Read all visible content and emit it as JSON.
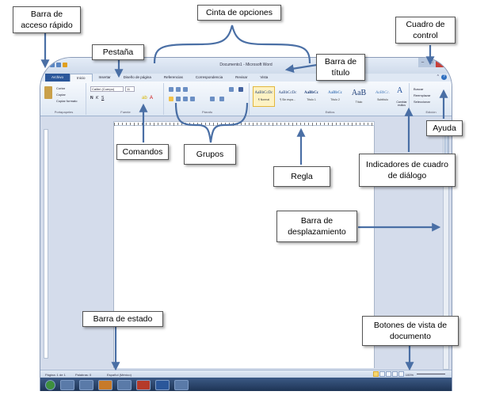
{
  "word": {
    "title": "Documento1 - Microsoft Word",
    "tabs": [
      "Archivo",
      "Inicio",
      "Insertar",
      "Diseño de página",
      "Referencias",
      "Correspondencia",
      "Revisar",
      "Vista"
    ],
    "active_tab": "Inicio",
    "groups": {
      "clipboard": {
        "label": "Portapapeles",
        "cut": "Cortar",
        "copy": "Copiar",
        "paste_format": "Copiar formato"
      },
      "font": {
        "label": "Fuente",
        "font_name": "Calibri (Cuerpo)",
        "font_size": "11"
      },
      "paragraph": {
        "label": "Párrafo"
      },
      "styles": {
        "label": "Estilos",
        "items": [
          {
            "sample": "AaBbCcDc",
            "name": "¶ Normal"
          },
          {
            "sample": "AaBbCcDc",
            "name": "¶ Sin espa..."
          },
          {
            "sample": "AaBbCc",
            "name": "Título 1"
          },
          {
            "sample": "AaBbCc",
            "name": "Título 2"
          },
          {
            "sample": "AaB",
            "name": "Título"
          },
          {
            "sample": "AaBbCc.",
            "name": "Subtítulo"
          }
        ],
        "change_styles": "Cambiar estilos"
      },
      "editing": {
        "label": "Edición",
        "find": "Buscar",
        "replace": "Reemplazar",
        "select": "Seleccionar"
      }
    },
    "status": {
      "page": "Página: 1 de 1",
      "words": "Palabras: 0",
      "language": "Español (México)",
      "zoom": "100%"
    }
  },
  "callouts": {
    "barra_acceso": "Barra de acceso rápido",
    "pestana": "Pestaña",
    "cinta": "Cinta de opciones",
    "barra_titulo": "Barra de título",
    "cuadro_control": "Cuadro de control",
    "ayuda": "Ayuda",
    "comandos": "Comandos",
    "grupos": "Grupos",
    "regla": "Regla",
    "indicadores": "Indicadores de cuadro de diálogo",
    "barra_desplazamiento": "Barra de desplazamiento",
    "barra_estado": "Barra de estado",
    "botones_vista": "Botones de vista de documento"
  },
  "colors": {
    "accent": "#2f4f8a",
    "arrow": "#4a6fa5",
    "close_button": "#c7403a"
  }
}
